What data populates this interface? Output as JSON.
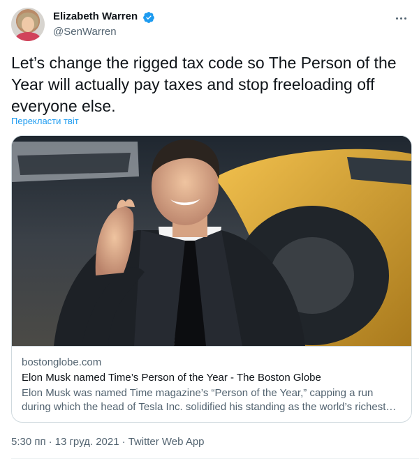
{
  "author": {
    "name": "Elizabeth Warren",
    "handle": "@SenWarren",
    "verified": true
  },
  "tweet": {
    "text": "Let’s change the rigged tax code so The Person of the Year will actually pay taxes and stop freeloading off everyone else.",
    "translate_label": "Перекласти твіт"
  },
  "card": {
    "domain": "bostonglobe.com",
    "title": "Elon Musk named Time’s Person of the Year - The Boston Globe",
    "description": "Elon Musk was named Time magazine’s “Person of the Year,” capping a run during which the head of Tesla Inc. solidified his standing as the world’s richest…"
  },
  "meta": {
    "time": "5:30 пп",
    "date": "13 груд. 2021",
    "source": "Twitter Web App"
  },
  "colors": {
    "accent": "#1d9bf0",
    "text": "#0f1419",
    "muted": "#536471",
    "border": "#cfd9de"
  },
  "icons": {
    "verified": "verified-badge-icon",
    "more": "more-options-icon"
  }
}
